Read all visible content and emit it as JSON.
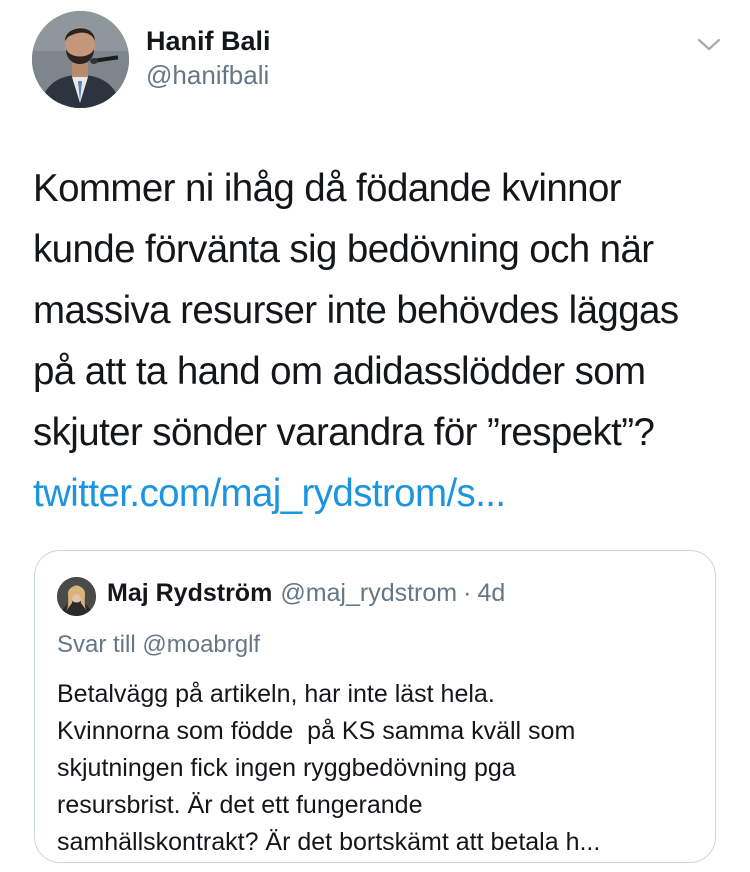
{
  "author": {
    "name": "Hanif Bali",
    "handle": "@hanifbali",
    "avatar_icon": "profile-photo"
  },
  "menu_icon": "chevron-down-icon",
  "tweet": {
    "lines": [
      "Kommer ni ihåg då födande kvinnor",
      "kunde förvänta sig bedövning och när",
      "massiva resurser inte behövdes läggas",
      "på att ta hand om adidasslödder som",
      "skjuter sönder varandra för ”respekt”?"
    ],
    "link": "twitter.com/maj_rydstrom/s..."
  },
  "quoted_tweet": {
    "name": "Maj Rydström",
    "handle": "@maj_rydstrom",
    "separator": "·",
    "time": "4d",
    "reply_prefix": "Svar till",
    "reply_to": "@moabrglf",
    "lines": [
      "Betalvägg på artikeln, har inte läst hela.",
      "Kvinnorna som födde  på KS samma kväll som",
      "skjutningen fick ingen ryggbedövning pga",
      "resursbrist. Är det ett fungerande",
      "samhällskontrakt? Är det bortskämt att betala h..."
    ]
  },
  "colors": {
    "text": "#14171a",
    "secondary": "#657786",
    "link": "#1b95e0",
    "border": "#ccd6dd"
  }
}
